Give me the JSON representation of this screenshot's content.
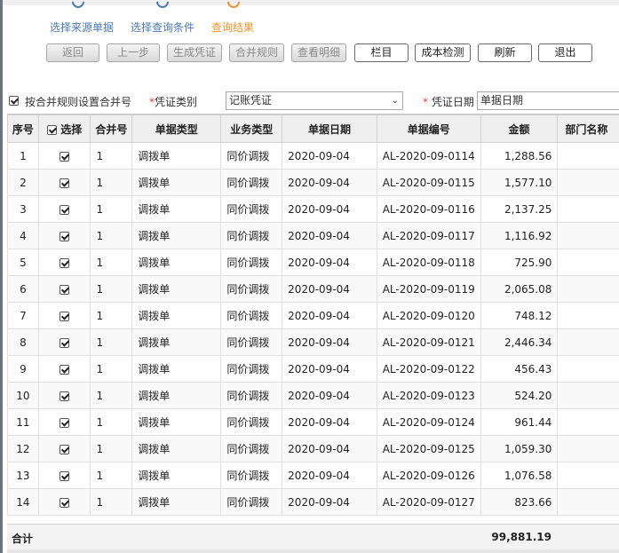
{
  "steps": [
    {
      "label": "选择来源单据",
      "active": false
    },
    {
      "label": "选择查询条件",
      "active": false
    },
    {
      "label": "查询结果",
      "active": true
    }
  ],
  "toolbar": {
    "back": "返回",
    "prev": "上一步",
    "generate": "生成凭证",
    "merge_rule": "合并规则",
    "view_detail": "查看明细",
    "columns": "栏目",
    "cost_check": "成本检测",
    "refresh": "刷新",
    "exit": "退出"
  },
  "options": {
    "merge_by_rule_label": "按合并规则设置合并号",
    "merge_by_rule_checked": true,
    "voucher_type_label": "凭证类别",
    "voucher_type_value": "记账凭证",
    "voucher_date_label": "凭证日期",
    "voucher_date_value": "单据日期"
  },
  "table": {
    "headers": {
      "seq": "序号",
      "select": "选择",
      "merge_no": "合并号",
      "doc_type": "单据类型",
      "biz_type": "业务类型",
      "doc_date": "单据日期",
      "doc_no": "单据编号",
      "amount": "金额",
      "dept": "部门名称"
    },
    "rows": [
      {
        "seq": "1",
        "merge_no": "1",
        "doc_type": "调拨单",
        "biz_type": "同价调拨",
        "doc_date": "2020-09-04",
        "doc_no": "AL-2020-09-0114",
        "amount": "1,288.56"
      },
      {
        "seq": "2",
        "merge_no": "1",
        "doc_type": "调拨单",
        "biz_type": "同价调拨",
        "doc_date": "2020-09-04",
        "doc_no": "AL-2020-09-0115",
        "amount": "1,577.10"
      },
      {
        "seq": "3",
        "merge_no": "1",
        "doc_type": "调拨单",
        "biz_type": "同价调拨",
        "doc_date": "2020-09-04",
        "doc_no": "AL-2020-09-0116",
        "amount": "2,137.25"
      },
      {
        "seq": "4",
        "merge_no": "1",
        "doc_type": "调拨单",
        "biz_type": "同价调拨",
        "doc_date": "2020-09-04",
        "doc_no": "AL-2020-09-0117",
        "amount": "1,116.92"
      },
      {
        "seq": "5",
        "merge_no": "1",
        "doc_type": "调拨单",
        "biz_type": "同价调拨",
        "doc_date": "2020-09-04",
        "doc_no": "AL-2020-09-0118",
        "amount": "725.90"
      },
      {
        "seq": "6",
        "merge_no": "1",
        "doc_type": "调拨单",
        "biz_type": "同价调拨",
        "doc_date": "2020-09-04",
        "doc_no": "AL-2020-09-0119",
        "amount": "2,065.08"
      },
      {
        "seq": "7",
        "merge_no": "1",
        "doc_type": "调拨单",
        "biz_type": "同价调拨",
        "doc_date": "2020-09-04",
        "doc_no": "AL-2020-09-0120",
        "amount": "748.12"
      },
      {
        "seq": "8",
        "merge_no": "1",
        "doc_type": "调拨单",
        "biz_type": "同价调拨",
        "doc_date": "2020-09-04",
        "doc_no": "AL-2020-09-0121",
        "amount": "2,446.34"
      },
      {
        "seq": "9",
        "merge_no": "1",
        "doc_type": "调拨单",
        "biz_type": "同价调拨",
        "doc_date": "2020-09-04",
        "doc_no": "AL-2020-09-0122",
        "amount": "456.43"
      },
      {
        "seq": "10",
        "merge_no": "1",
        "doc_type": "调拨单",
        "biz_type": "同价调拨",
        "doc_date": "2020-09-04",
        "doc_no": "AL-2020-09-0123",
        "amount": "524.20"
      },
      {
        "seq": "11",
        "merge_no": "1",
        "doc_type": "调拨单",
        "biz_type": "同价调拨",
        "doc_date": "2020-09-04",
        "doc_no": "AL-2020-09-0124",
        "amount": "961.44"
      },
      {
        "seq": "12",
        "merge_no": "1",
        "doc_type": "调拨单",
        "biz_type": "同价调拨",
        "doc_date": "2020-09-04",
        "doc_no": "AL-2020-09-0125",
        "amount": "1,059.30"
      },
      {
        "seq": "13",
        "merge_no": "1",
        "doc_type": "调拨单",
        "biz_type": "同价调拨",
        "doc_date": "2020-09-04",
        "doc_no": "AL-2020-09-0126",
        "amount": "1,076.58"
      },
      {
        "seq": "14",
        "merge_no": "1",
        "doc_type": "调拨单",
        "biz_type": "同价调拨",
        "doc_date": "2020-09-04",
        "doc_no": "AL-2020-09-0127",
        "amount": "823.66"
      }
    ]
  },
  "totals": {
    "label": "合计",
    "amount": "99,881.19"
  }
}
